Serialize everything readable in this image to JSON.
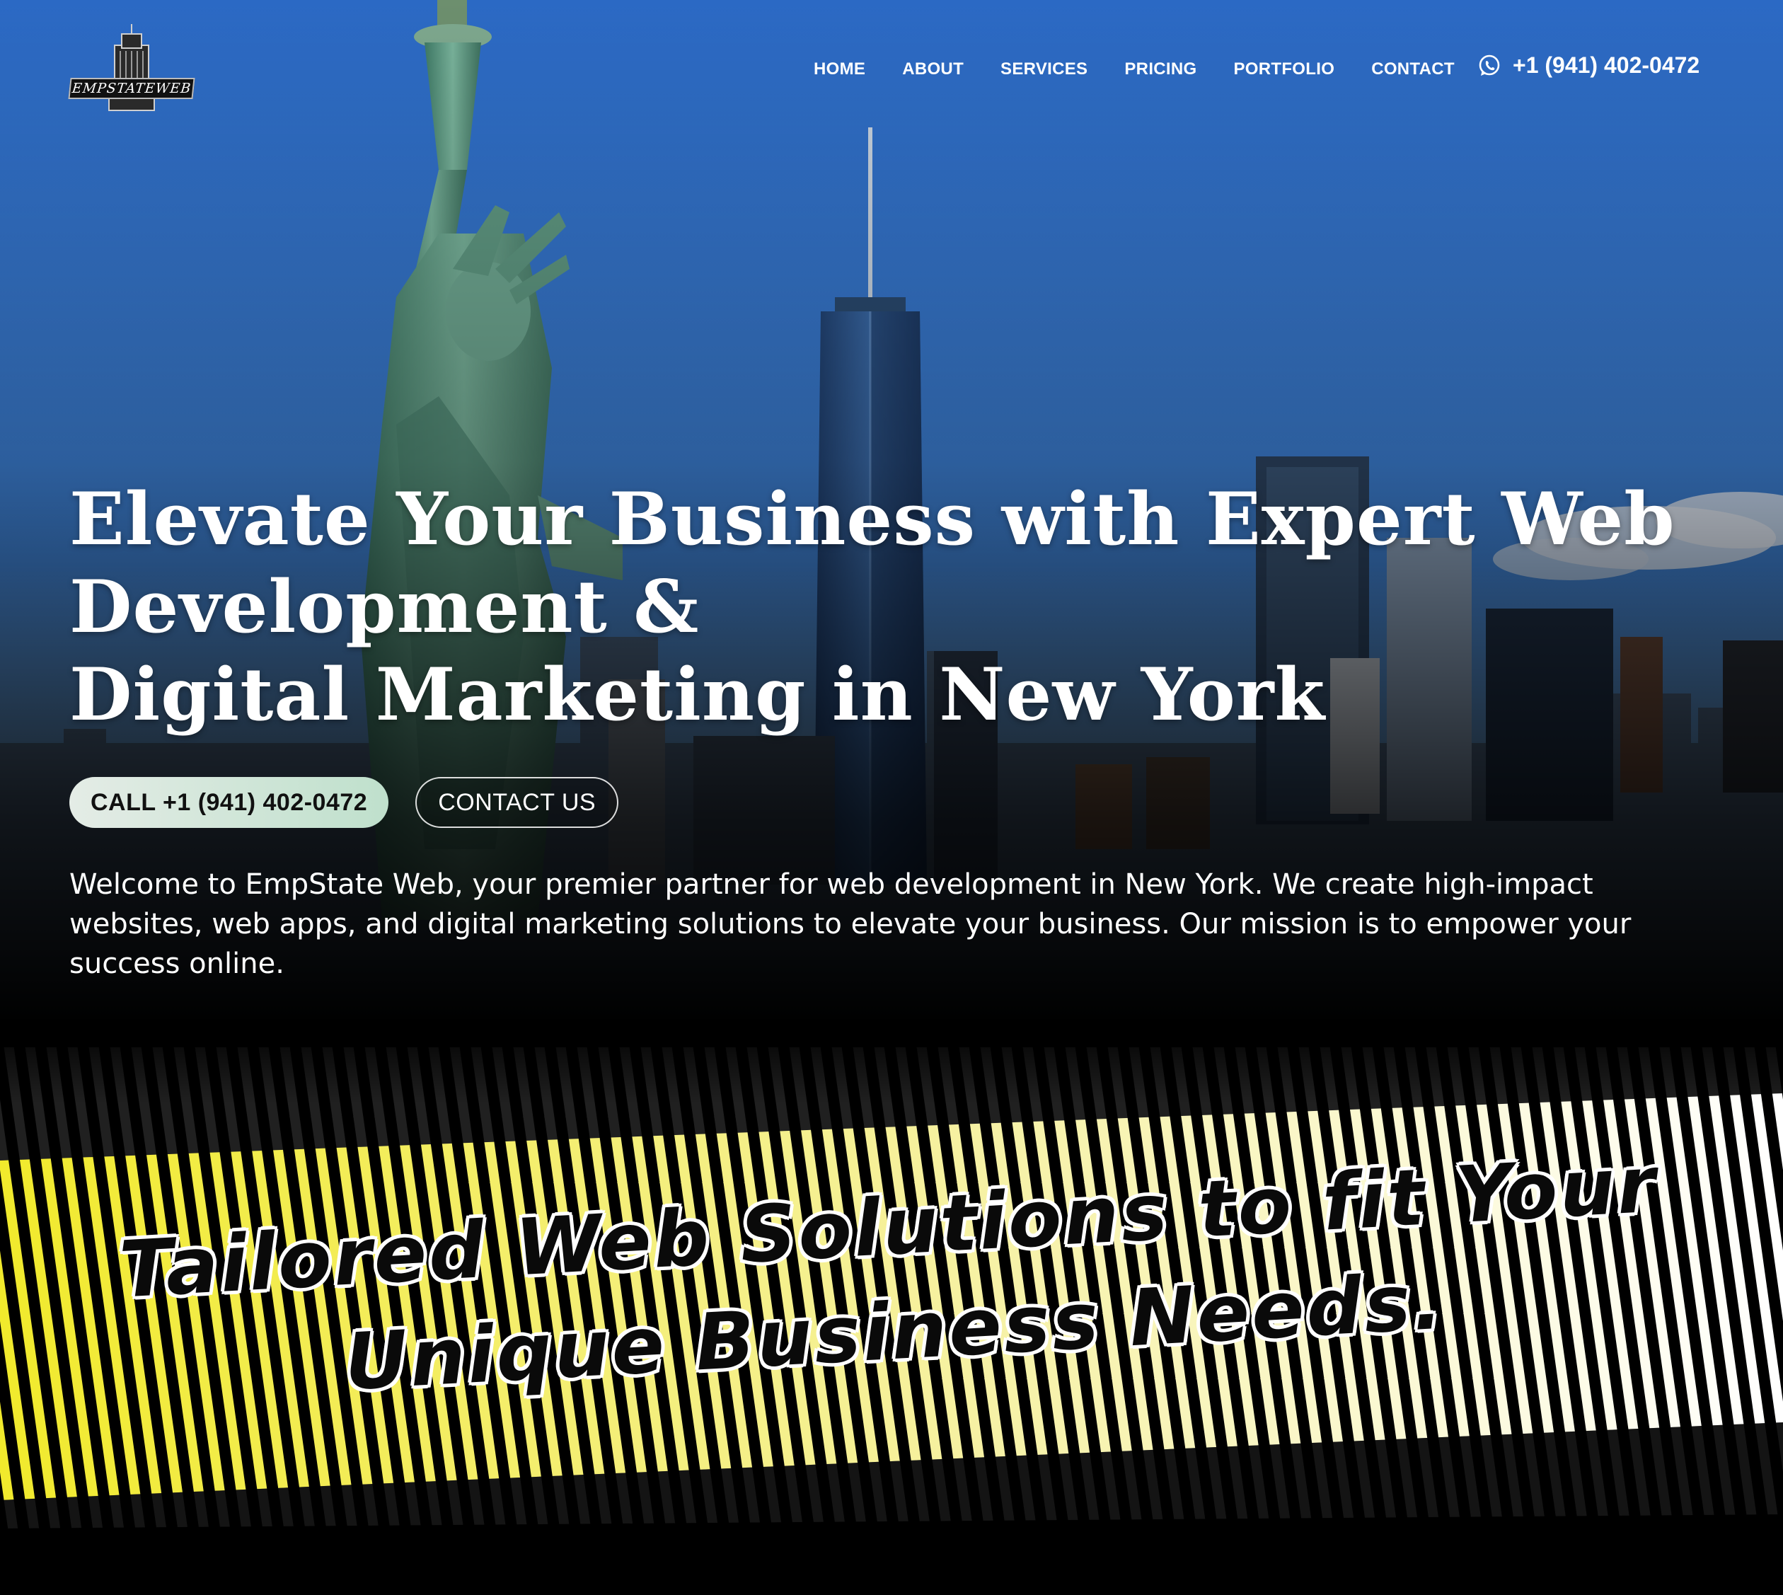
{
  "brand": {
    "logo_text": "EMPSTATEWEB"
  },
  "nav": {
    "items": [
      {
        "label": "HOME"
      },
      {
        "label": "ABOUT"
      },
      {
        "label": "SERVICES"
      },
      {
        "label": "PRICING"
      },
      {
        "label": "PORTFOLIO"
      },
      {
        "label": "CONTACT"
      }
    ],
    "phone": "+1 (941) 402-0472",
    "phone_icon": "whatsapp-icon"
  },
  "hero": {
    "headline_lines": [
      "Elevate Your Business with Expert Web",
      "Development &",
      "Digital Marketing in New York"
    ],
    "call_button": "CALL +1 (941) 402-0472",
    "contact_button": "CONTACT US",
    "intro": "Welcome to EmpState Web, your premier partner for web development in New York. We create high-impact websites, web apps, and digital marketing solutions to elevate your business. Our mission is to empower your success online."
  },
  "band": {
    "tagline": "Tailored Web Solutions to fit Your Unique Business Needs."
  },
  "colors": {
    "sky_top": "#2f6fc6",
    "sky_bottom": "#4a8ad8",
    "statue": "#5f9a84",
    "stripe_yellow": "#f4ef3a",
    "stripe_white": "#ffffff",
    "button_mint": "#bfe0cc"
  }
}
